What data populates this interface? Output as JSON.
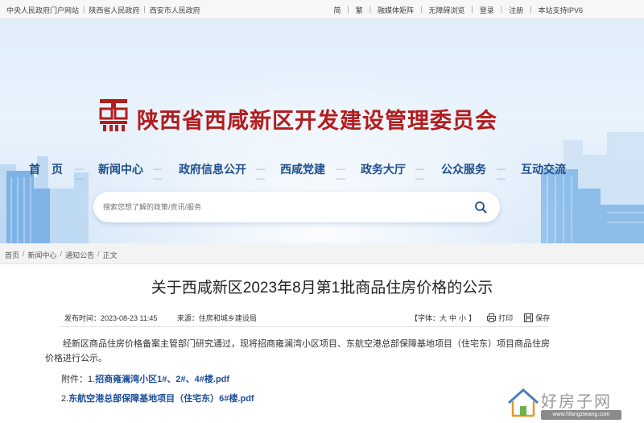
{
  "topbar": {
    "left": [
      "中央人民政府门户网站",
      "陕西省人民政府",
      "西安市人民政府"
    ],
    "lang_simplified": "简",
    "lang_traditional": "繁",
    "links": [
      "融媒体矩阵",
      "无障碍浏览",
      "登录",
      "注册",
      "本站支持IPV6"
    ]
  },
  "header": {
    "site_title": "陕西省西咸新区开发建设管理委员会",
    "nav": [
      "首　页",
      "新闻中心",
      "政府信息公开",
      "西咸党建",
      "政务大厅",
      "公众服务",
      "互动交流"
    ],
    "search_placeholder": "搜索您想了解的政策/资讯/服务"
  },
  "breadcrumb": [
    "首页",
    "新闻中心",
    "通知公告",
    "正文"
  ],
  "article": {
    "title": "关于西咸新区2023年8月第1批商品住房价格的公示",
    "publish_time": "发布时间：2023-08-23 11:45",
    "source": "来源：住房和城乡建设局",
    "font_label": "【字体：",
    "font_large": "大",
    "font_medium": "中",
    "font_small": "小",
    "font_close": "】",
    "print": "打印",
    "save": "保存",
    "body": "经新区商品住房价格备案主管部门研究通过，现将招商雍澜湾小区项目、东航空港总部保障基地项目（住宅东）项目商品住房价格进行公示。",
    "attachment_prefix": "附件：",
    "attachments": [
      {
        "index": "1.",
        "name": "招商雍澜湾小区1#、2#、4#楼.pdf"
      },
      {
        "index": "2.",
        "name": "东航空港总部保障基地项目（住宅东）6#楼.pdf"
      }
    ]
  },
  "watermark": {
    "text": "好房子网",
    "url": "www.hfangziwang.com"
  },
  "colors": {
    "title_red": "#b21d1d",
    "nav_blue": "#1f4e8c",
    "link_blue": "#1d4f9a"
  }
}
